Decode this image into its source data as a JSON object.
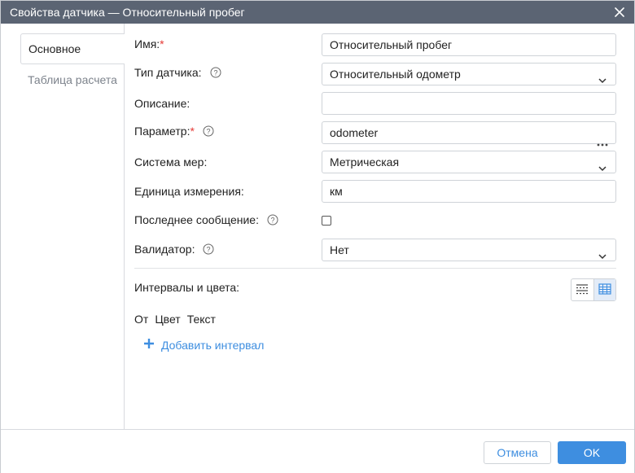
{
  "dialog": {
    "title": "Свойства датчика — Относительный пробег",
    "close_icon": "close-icon"
  },
  "sidebar": {
    "tabs": [
      {
        "label": "Основное",
        "active": true
      },
      {
        "label": "Таблица расчета",
        "active": false
      }
    ]
  },
  "form": {
    "name": {
      "label": "Имя:",
      "required_mark": "*",
      "value": "Относительный пробег"
    },
    "sensor_type": {
      "label": "Тип датчика:",
      "help_icon": "help-icon",
      "value": "Относительный одометр"
    },
    "description": {
      "label": "Описание:",
      "value": ""
    },
    "parameter": {
      "label": "Параметр:",
      "required_mark": "*",
      "help_icon": "help-icon",
      "value": "odometer",
      "more_icon": "more-horizontal-icon"
    },
    "measure_system": {
      "label": "Система мер:",
      "value": "Метрическая"
    },
    "unit": {
      "label": "Единица измерения:",
      "value": "км"
    },
    "last_message": {
      "label": "Последнее сообщение:",
      "help_icon": "help-icon",
      "checked": false
    },
    "validator": {
      "label": "Валидатор:",
      "help_icon": "help-icon",
      "value": "Нет"
    }
  },
  "intervals": {
    "label": "Интервалы и цвета:",
    "columns": [
      "От",
      "Цвет",
      "Текст"
    ],
    "add_label": "Добавить интервал",
    "add_icon": "plus-icon",
    "view_icons": [
      "list-view-icon",
      "table-view-icon"
    ],
    "selected_view": "table"
  },
  "footer": {
    "cancel_label": "Отмена",
    "ok_label": "OK"
  },
  "colors": {
    "titlebar": "#5b6473",
    "accent": "#3e8ee0",
    "required": "#e53935"
  }
}
